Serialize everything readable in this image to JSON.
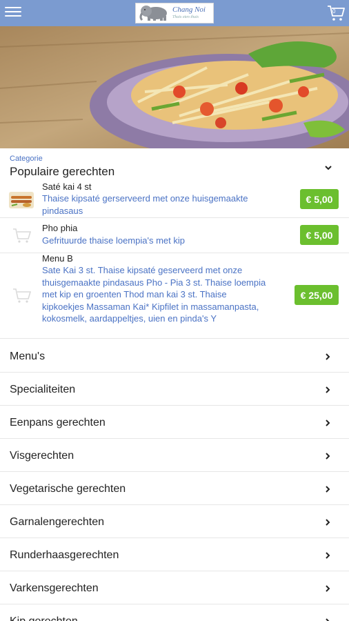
{
  "header": {
    "logo_name": "Chang Noi",
    "logo_tagline": "Thais eten thuis",
    "cart_count": "0",
    "icons": {
      "menu": "hamburger-menu-icon",
      "cart": "shopping-cart-icon",
      "logo": "elephant-logo-icon"
    },
    "colors": {
      "bar": "#7b9bd0"
    }
  },
  "category": {
    "label": "Categorie",
    "selected": "Populaire gerechten"
  },
  "products": [
    {
      "name": "Saté kai 4 st",
      "description": "Thaise kipsaté gerserveerd met onze huisgemaakte pindasaus",
      "price": "€ 5,00",
      "thumb": "sate-thumbnail"
    },
    {
      "name": "Pho phia",
      "description": "Gefrituurde thaise loempia's met kip",
      "price": "€ 5,00",
      "thumb": "cart-outline-icon"
    },
    {
      "name": "Menu B",
      "description": "Sate Kai 3 st. Thaise kipsaté geserveerd met onze thuisgemaakte pindasaus Pho - Pia 3 st. Thaise loempia met kip en groenten Thod man kai 3 st. Thaise kipkoekjes Massaman Kai* Kipfilet in massamanpasta, kokosmelk, aardappeltjes, uien en pinda's Y",
      "price": "€ 25,00",
      "thumb": "cart-outline-icon"
    }
  ],
  "categories": [
    "Menu's",
    "Specialiteiten",
    "Eenpans gerechten",
    "Visgerechten",
    "Vegetarische gerechten",
    "Garnalengerechten",
    "Runderhaasgerechten",
    "Varkensgerechten",
    "Kip gerechten"
  ],
  "accent": {
    "price_green": "#6bbf2e",
    "link_blue": "#4a72c4"
  }
}
